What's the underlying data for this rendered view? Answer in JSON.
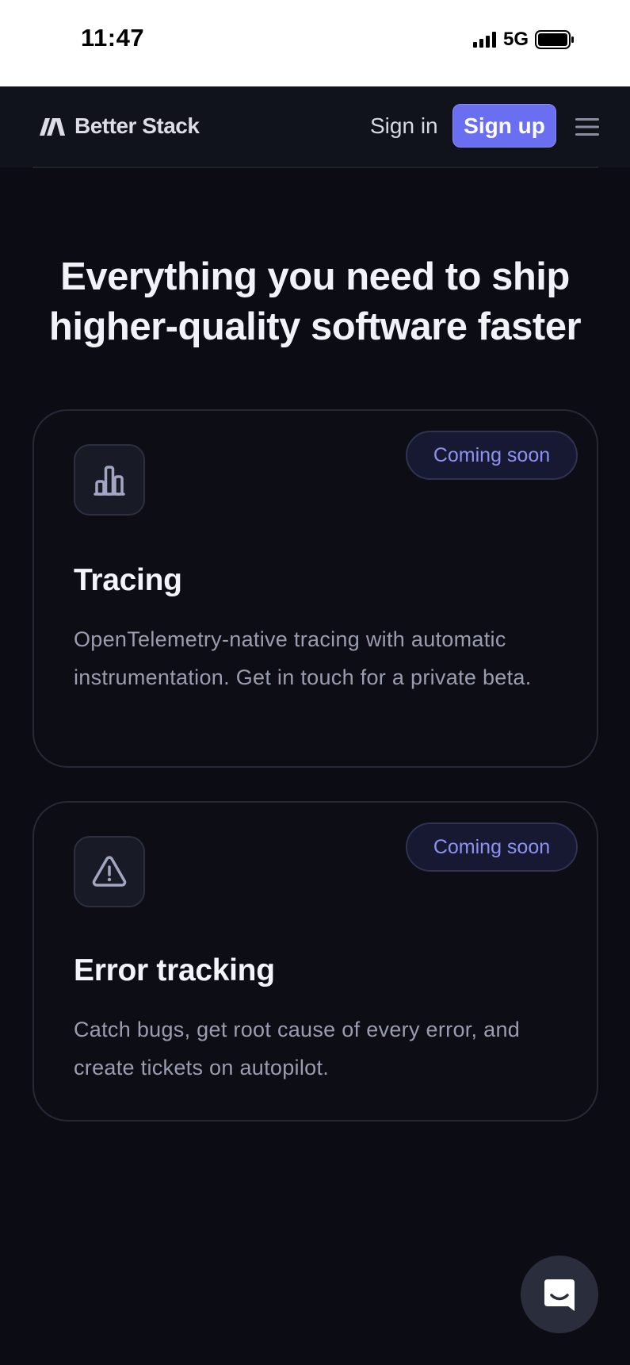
{
  "status_bar": {
    "time": "11:47",
    "network": "5G"
  },
  "nav": {
    "logo_text": "Better Stack",
    "sign_in_label": "Sign in",
    "sign_up_label": "Sign up"
  },
  "hero": {
    "headline": "Everything you need to ship higher-quality software faster"
  },
  "cards": [
    {
      "icon": "bar-chart-icon",
      "badge": "Coming soon",
      "title": "Tracing",
      "description": "OpenTelemetry-native tracing with automatic instrumentation. Get in touch for a private beta."
    },
    {
      "icon": "warning-triangle-icon",
      "badge": "Coming soon",
      "title": "Error tracking",
      "description": "Catch bugs, get root cause of every error, and create tickets on autopilot."
    }
  ],
  "colors": {
    "background": "#0b0c14",
    "accent": "#6a6ef0",
    "badge_text": "#8d91f2"
  },
  "chat": {
    "icon": "chat-icon"
  }
}
